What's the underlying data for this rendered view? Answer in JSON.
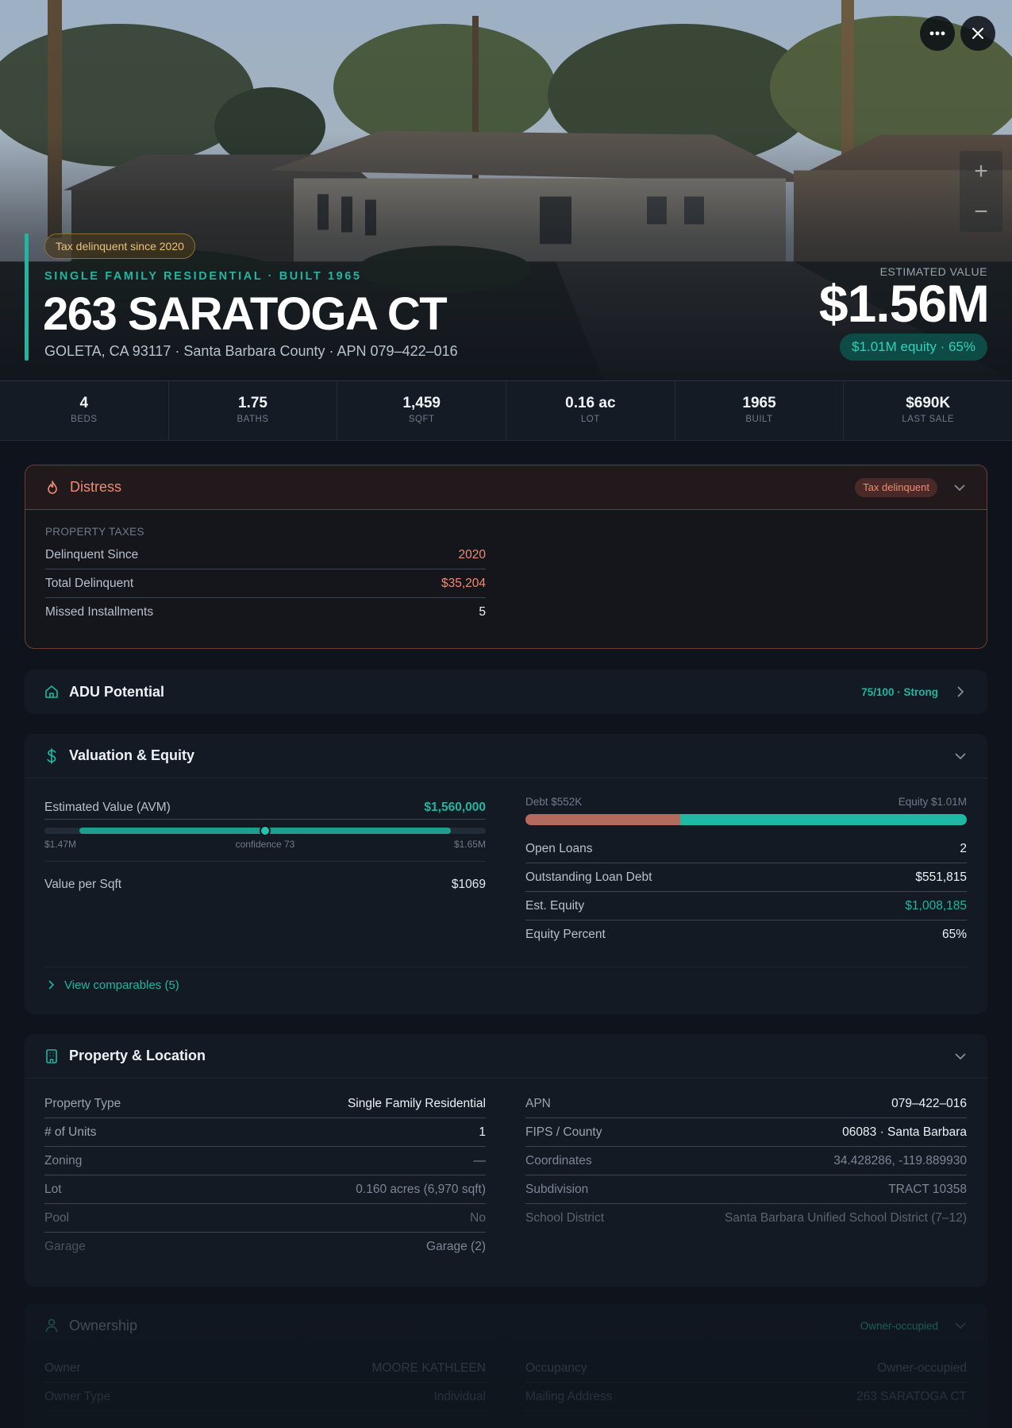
{
  "hero": {
    "tax_badge": "Tax delinquent since 2020",
    "subtitle": "SINGLE FAMILY RESIDENTIAL · BUILT 1965",
    "title": "263 SARATOGA CT",
    "address": "GOLETA, CA 93117 · Santa Barbara County · APN 079–422–016",
    "estimated_value_label": "ESTIMATED VALUE",
    "estimated_value": "$1.56M",
    "equity": "$1.01M equity · 65%",
    "more_icon": "more-horizontal-icon",
    "close_icon": "close-icon",
    "zoom_in": "+",
    "zoom_out": "−"
  },
  "stats": [
    {
      "value": "4",
      "label": "BEDS"
    },
    {
      "value": "1.75",
      "label": "BATHS"
    },
    {
      "value": "1,459",
      "label": "SQFT"
    },
    {
      "value": "0.16 ac",
      "label": "LOT"
    },
    {
      "value": "1965",
      "label": "BUILT"
    },
    {
      "value": "$690K",
      "label": "LAST SALE"
    }
  ],
  "distress": {
    "title": "Distress",
    "badge": "Tax delinquent",
    "icon": "flame-icon",
    "section_label": "PROPERTY TAXES",
    "rows": [
      {
        "label": "Delinquent Since",
        "value": "2020"
      },
      {
        "label": "Total Delinquent",
        "value": "$35,204"
      },
      {
        "label": "Missed Installments",
        "value": "5"
      }
    ]
  },
  "adu": {
    "title": "ADU Potential",
    "score": "75/100 · Strong",
    "icon": "home-icon"
  },
  "valuation": {
    "title": "Valuation & Equity",
    "icon": "dollar-icon",
    "avm_label": "Estimated Value (AVM)",
    "avm_value": "$1,560,000",
    "range_low": "$1.47M",
    "range_high": "$1.65M",
    "confidence": "confidence 73",
    "avm_range_start_pct": 8,
    "avm_range_end_pct": 92,
    "avm_point_pct": 50,
    "vps_label": "Value per Sqft",
    "vps_value": "$1069",
    "debt_label": "Debt $552K",
    "equity_label": "Equity $1.01M",
    "debt_fraction": 0.35,
    "rows": [
      {
        "label": "Open Loans",
        "value": "2"
      },
      {
        "label": "Outstanding Loan Debt",
        "value": "$551,815"
      },
      {
        "label": "Est. Equity",
        "value": "$1,008,185"
      },
      {
        "label": "Equity Percent",
        "value": "65%"
      }
    ],
    "comparables": "View comparables (5)"
  },
  "property": {
    "title": "Property & Location",
    "icon": "building-icon",
    "left": [
      {
        "label": "Property Type",
        "value": "Single Family Residential"
      },
      {
        "label": "# of Units",
        "value": "1"
      },
      {
        "label": "Zoning",
        "value": "—"
      },
      {
        "label": "Lot",
        "value": "0.160 acres (6,970 sqft)"
      },
      {
        "label": "Pool",
        "value": "No"
      },
      {
        "label": "Garage",
        "value": "Garage (2)"
      }
    ],
    "right": [
      {
        "label": "APN",
        "value": "079–422–016"
      },
      {
        "label": "FIPS / County",
        "value": "06083 · Santa Barbara"
      },
      {
        "label": "Coordinates",
        "value": "34.428286, -119.889930"
      },
      {
        "label": "Subdivision",
        "value": "TRACT 10358"
      },
      {
        "label": "School District",
        "value": "Santa Barbara Unified School District (7–12)"
      }
    ]
  },
  "ownership": {
    "title": "Ownership",
    "badge": "Owner-occupied",
    "icon": "user-icon",
    "left": [
      {
        "label": "Owner",
        "value": "MOORE KATHLEEN"
      },
      {
        "label": "Owner Type",
        "value": "Individual"
      }
    ],
    "right": [
      {
        "label": "Occupancy",
        "value": "Owner-occupied"
      },
      {
        "label": "Mailing Address",
        "value": "263 SARATOGA CT"
      }
    ]
  },
  "colors": {
    "accent": "#20b6a0",
    "distress": "#ef8a75",
    "background": "#0f141c"
  }
}
